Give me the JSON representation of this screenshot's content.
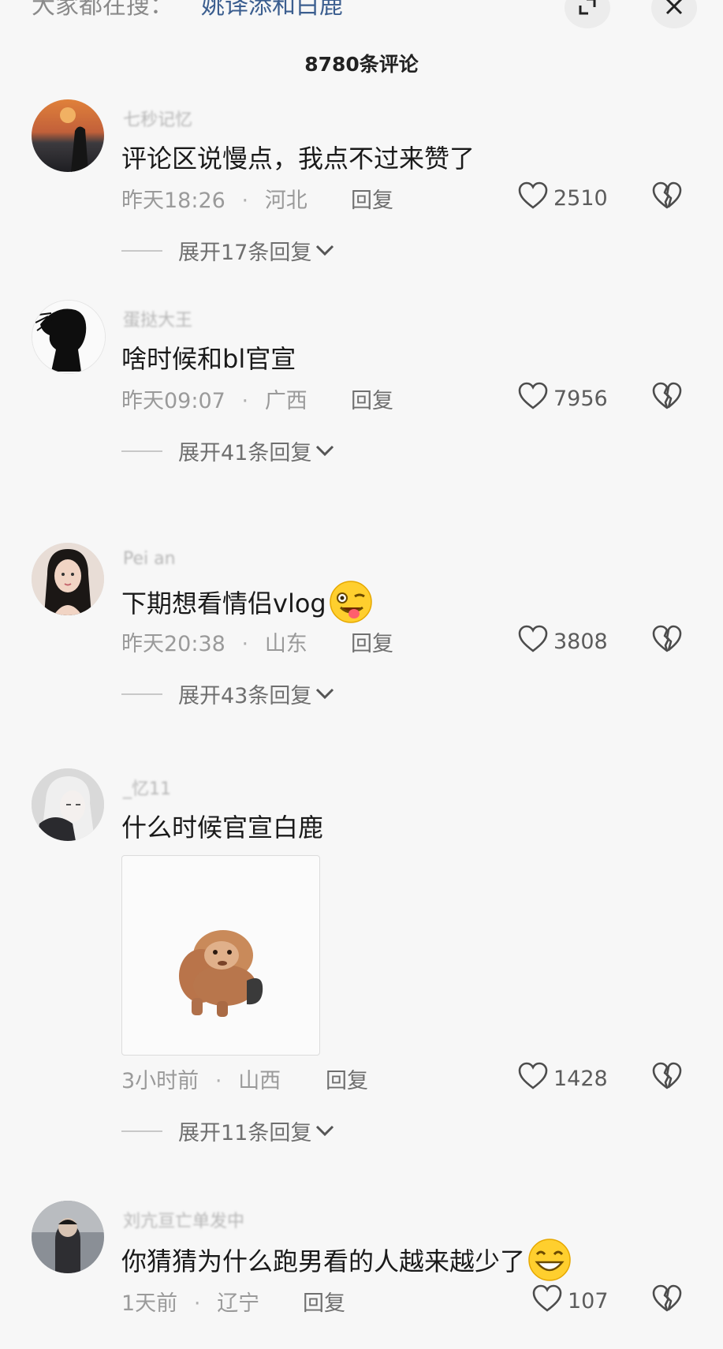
{
  "header": {
    "search_prefix": "大家都在搜：",
    "search_term": "姚译添和白鹿",
    "search_icon": "search-icon",
    "expand_icon": "expand-icon",
    "close_icon": "close-icon",
    "comment_count_title": "8780条评论"
  },
  "comments": [
    {
      "username": "七秒记忆",
      "text": "评论区说慢点，我点不过来赞了",
      "time": "昨天18:26",
      "location": "河北",
      "reply_label": "回复",
      "likes": "2510",
      "expand_label": "展开17条回复"
    },
    {
      "username": "蛋挞大王",
      "text": "啥时候和bl官宣",
      "time": "昨天09:07",
      "location": "广西",
      "reply_label": "回复",
      "likes": "7956",
      "expand_label": "展开41条回复"
    },
    {
      "username": "Pei an",
      "text": "下期想看情侣vlog",
      "emoji": "wink-tongue-emoji",
      "time": "昨天20:38",
      "location": "山东",
      "reply_label": "回复",
      "likes": "3808",
      "expand_label": "展开43条回复"
    },
    {
      "username": "_忆11",
      "text": "什么时候官宣白鹿",
      "sticker": "monkey-sticker",
      "time": "3小时前",
      "location": "山西",
      "reply_label": "回复",
      "likes": "1428",
      "expand_label": "展开11条回复"
    },
    {
      "username": "刘亢亘亡单发中",
      "text": "你猜猜为什么跑男看的人越来越少了",
      "emoji": "grin-emoji",
      "time": "1天前",
      "location": "辽宁",
      "reply_label": "回复",
      "likes": "107"
    }
  ]
}
